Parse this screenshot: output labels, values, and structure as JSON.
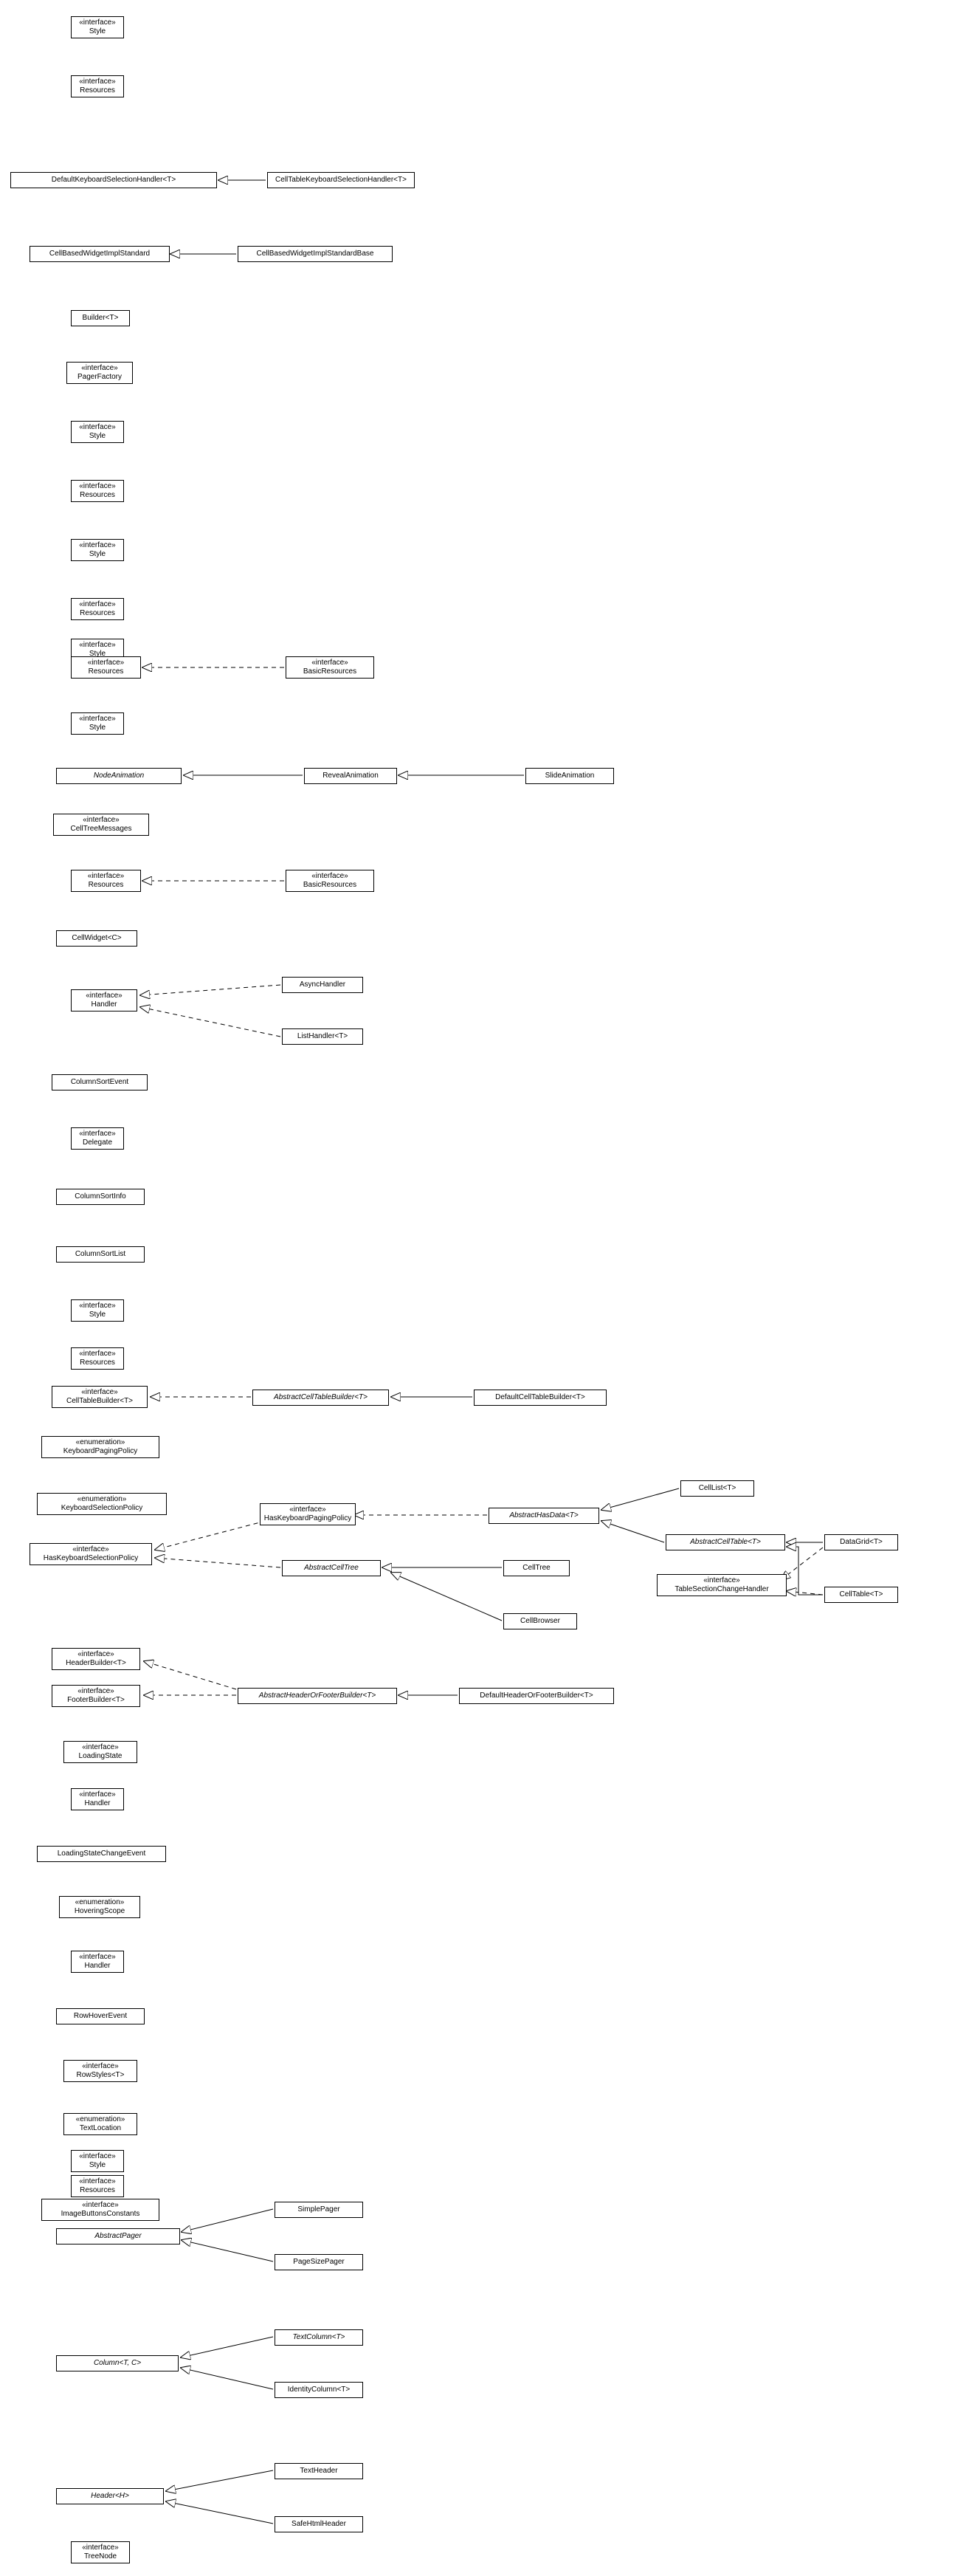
{
  "diagram_type": "uml_class_hierarchy",
  "stereotype_interface": "«interface»",
  "stereotype_enumeration": "«enumeration»",
  "nodes": {
    "n1": {
      "stereo": "interface",
      "name": "Style"
    },
    "n2": {
      "stereo": "interface",
      "name": "Resources"
    },
    "n3": {
      "name": "DefaultKeyboardSelectionHandler<T>"
    },
    "n4": {
      "name": "CellTableKeyboardSelectionHandler<T>"
    },
    "n5": {
      "name": "CellBasedWidgetImplStandard"
    },
    "n6": {
      "name": "CellBasedWidgetImplStandardBase"
    },
    "n7": {
      "name": "Builder<T>"
    },
    "n8": {
      "stereo": "interface",
      "name": "PagerFactory"
    },
    "n9": {
      "stereo": "interface",
      "name": "Style"
    },
    "n10": {
      "stereo": "interface",
      "name": "Resources"
    },
    "n11": {
      "stereo": "interface",
      "name": "Style"
    },
    "n12": {
      "stereo": "interface",
      "name": "Resources"
    },
    "n13": {
      "stereo": "interface",
      "name": "Style"
    },
    "n14": {
      "stereo": "interface",
      "name": "Resources"
    },
    "n15": {
      "stereo": "interface",
      "name": "BasicResources"
    },
    "n16": {
      "stereo": "interface",
      "name": "Style"
    },
    "n17": {
      "name": "NodeAnimation",
      "italic": true
    },
    "n18": {
      "name": "RevealAnimation"
    },
    "n19": {
      "name": "SlideAnimation"
    },
    "n20": {
      "stereo": "interface",
      "name": "CellTreeMessages"
    },
    "n21": {
      "stereo": "interface",
      "name": "Resources"
    },
    "n22": {
      "stereo": "interface",
      "name": "BasicResources"
    },
    "n23": {
      "name": "CellWidget<C>"
    },
    "n24": {
      "stereo": "interface",
      "name": "Handler"
    },
    "n25": {
      "name": "AsyncHandler"
    },
    "n26": {
      "name": "ListHandler<T>"
    },
    "n27": {
      "name": "ColumnSortEvent"
    },
    "n28": {
      "stereo": "interface",
      "name": "Delegate"
    },
    "n29": {
      "name": "ColumnSortInfo"
    },
    "n30": {
      "name": "ColumnSortList"
    },
    "n31": {
      "stereo": "interface",
      "name": "Style"
    },
    "n32": {
      "stereo": "interface",
      "name": "Resources"
    },
    "n33": {
      "stereo": "interface",
      "name": "CellTableBuilder<T>"
    },
    "n34": {
      "name": "AbstractCellTableBuilder<T>",
      "italic": true
    },
    "n35": {
      "name": "DefaultCellTableBuilder<T>"
    },
    "n36": {
      "stereo": "enumeration",
      "name": "KeyboardPagingPolicy"
    },
    "n37": {
      "stereo": "enumeration",
      "name": "KeyboardSelectionPolicy"
    },
    "n38": {
      "stereo": "interface",
      "name": "HasKeyboardPagingPolicy"
    },
    "n39": {
      "stereo": "interface",
      "name": "HasKeyboardSelectionPolicy"
    },
    "n40": {
      "name": "AbstractHasData<T>",
      "italic": true
    },
    "n41": {
      "name": "CellList<T>"
    },
    "n42": {
      "name": "AbstractCellTable<T>",
      "italic": true
    },
    "n43": {
      "name": "DataGrid<T>"
    },
    "n44": {
      "stereo": "interface",
      "name": "TableSectionChangeHandler"
    },
    "n45": {
      "name": "CellTable<T>"
    },
    "n46": {
      "name": "AbstractCellTree",
      "italic": true
    },
    "n47": {
      "name": "CellTree"
    },
    "n48": {
      "name": "CellBrowser"
    },
    "n49": {
      "stereo": "interface",
      "name": "HeaderBuilder<T>"
    },
    "n50": {
      "stereo": "interface",
      "name": "FooterBuilder<T>"
    },
    "n51": {
      "name": "AbstractHeaderOrFooterBuilder<T>",
      "italic": true
    },
    "n52": {
      "name": "DefaultHeaderOrFooterBuilder<T>"
    },
    "n53": {
      "stereo": "interface",
      "name": "LoadingState"
    },
    "n54": {
      "stereo": "interface",
      "name": "Handler"
    },
    "n55": {
      "name": "LoadingStateChangeEvent"
    },
    "n56": {
      "stereo": "enumeration",
      "name": "HoveringScope"
    },
    "n57": {
      "stereo": "interface",
      "name": "Handler"
    },
    "n58": {
      "name": "RowHoverEvent"
    },
    "n59": {
      "stereo": "interface",
      "name": "RowStyles<T>"
    },
    "n60": {
      "stereo": "enumeration",
      "name": "TextLocation"
    },
    "n61": {
      "stereo": "interface",
      "name": "Style"
    },
    "n62": {
      "stereo": "interface",
      "name": "Resources"
    },
    "n63": {
      "stereo": "interface",
      "name": "ImageButtonsConstants"
    },
    "n64": {
      "name": "AbstractPager",
      "italic": true
    },
    "n65": {
      "name": "SimplePager"
    },
    "n66": {
      "name": "PageSizePager"
    },
    "n67": {
      "name": "Column<T, C>",
      "italic": true
    },
    "n68": {
      "name": "TextColumn<T>",
      "italic": true
    },
    "n69": {
      "name": "IdentityColumn<T>"
    },
    "n70": {
      "name": "Header<H>",
      "italic": true
    },
    "n71": {
      "name": "TextHeader"
    },
    "n72": {
      "name": "SafeHtmlHeader"
    },
    "n73": {
      "stereo": "interface",
      "name": "TreeNode"
    }
  }
}
